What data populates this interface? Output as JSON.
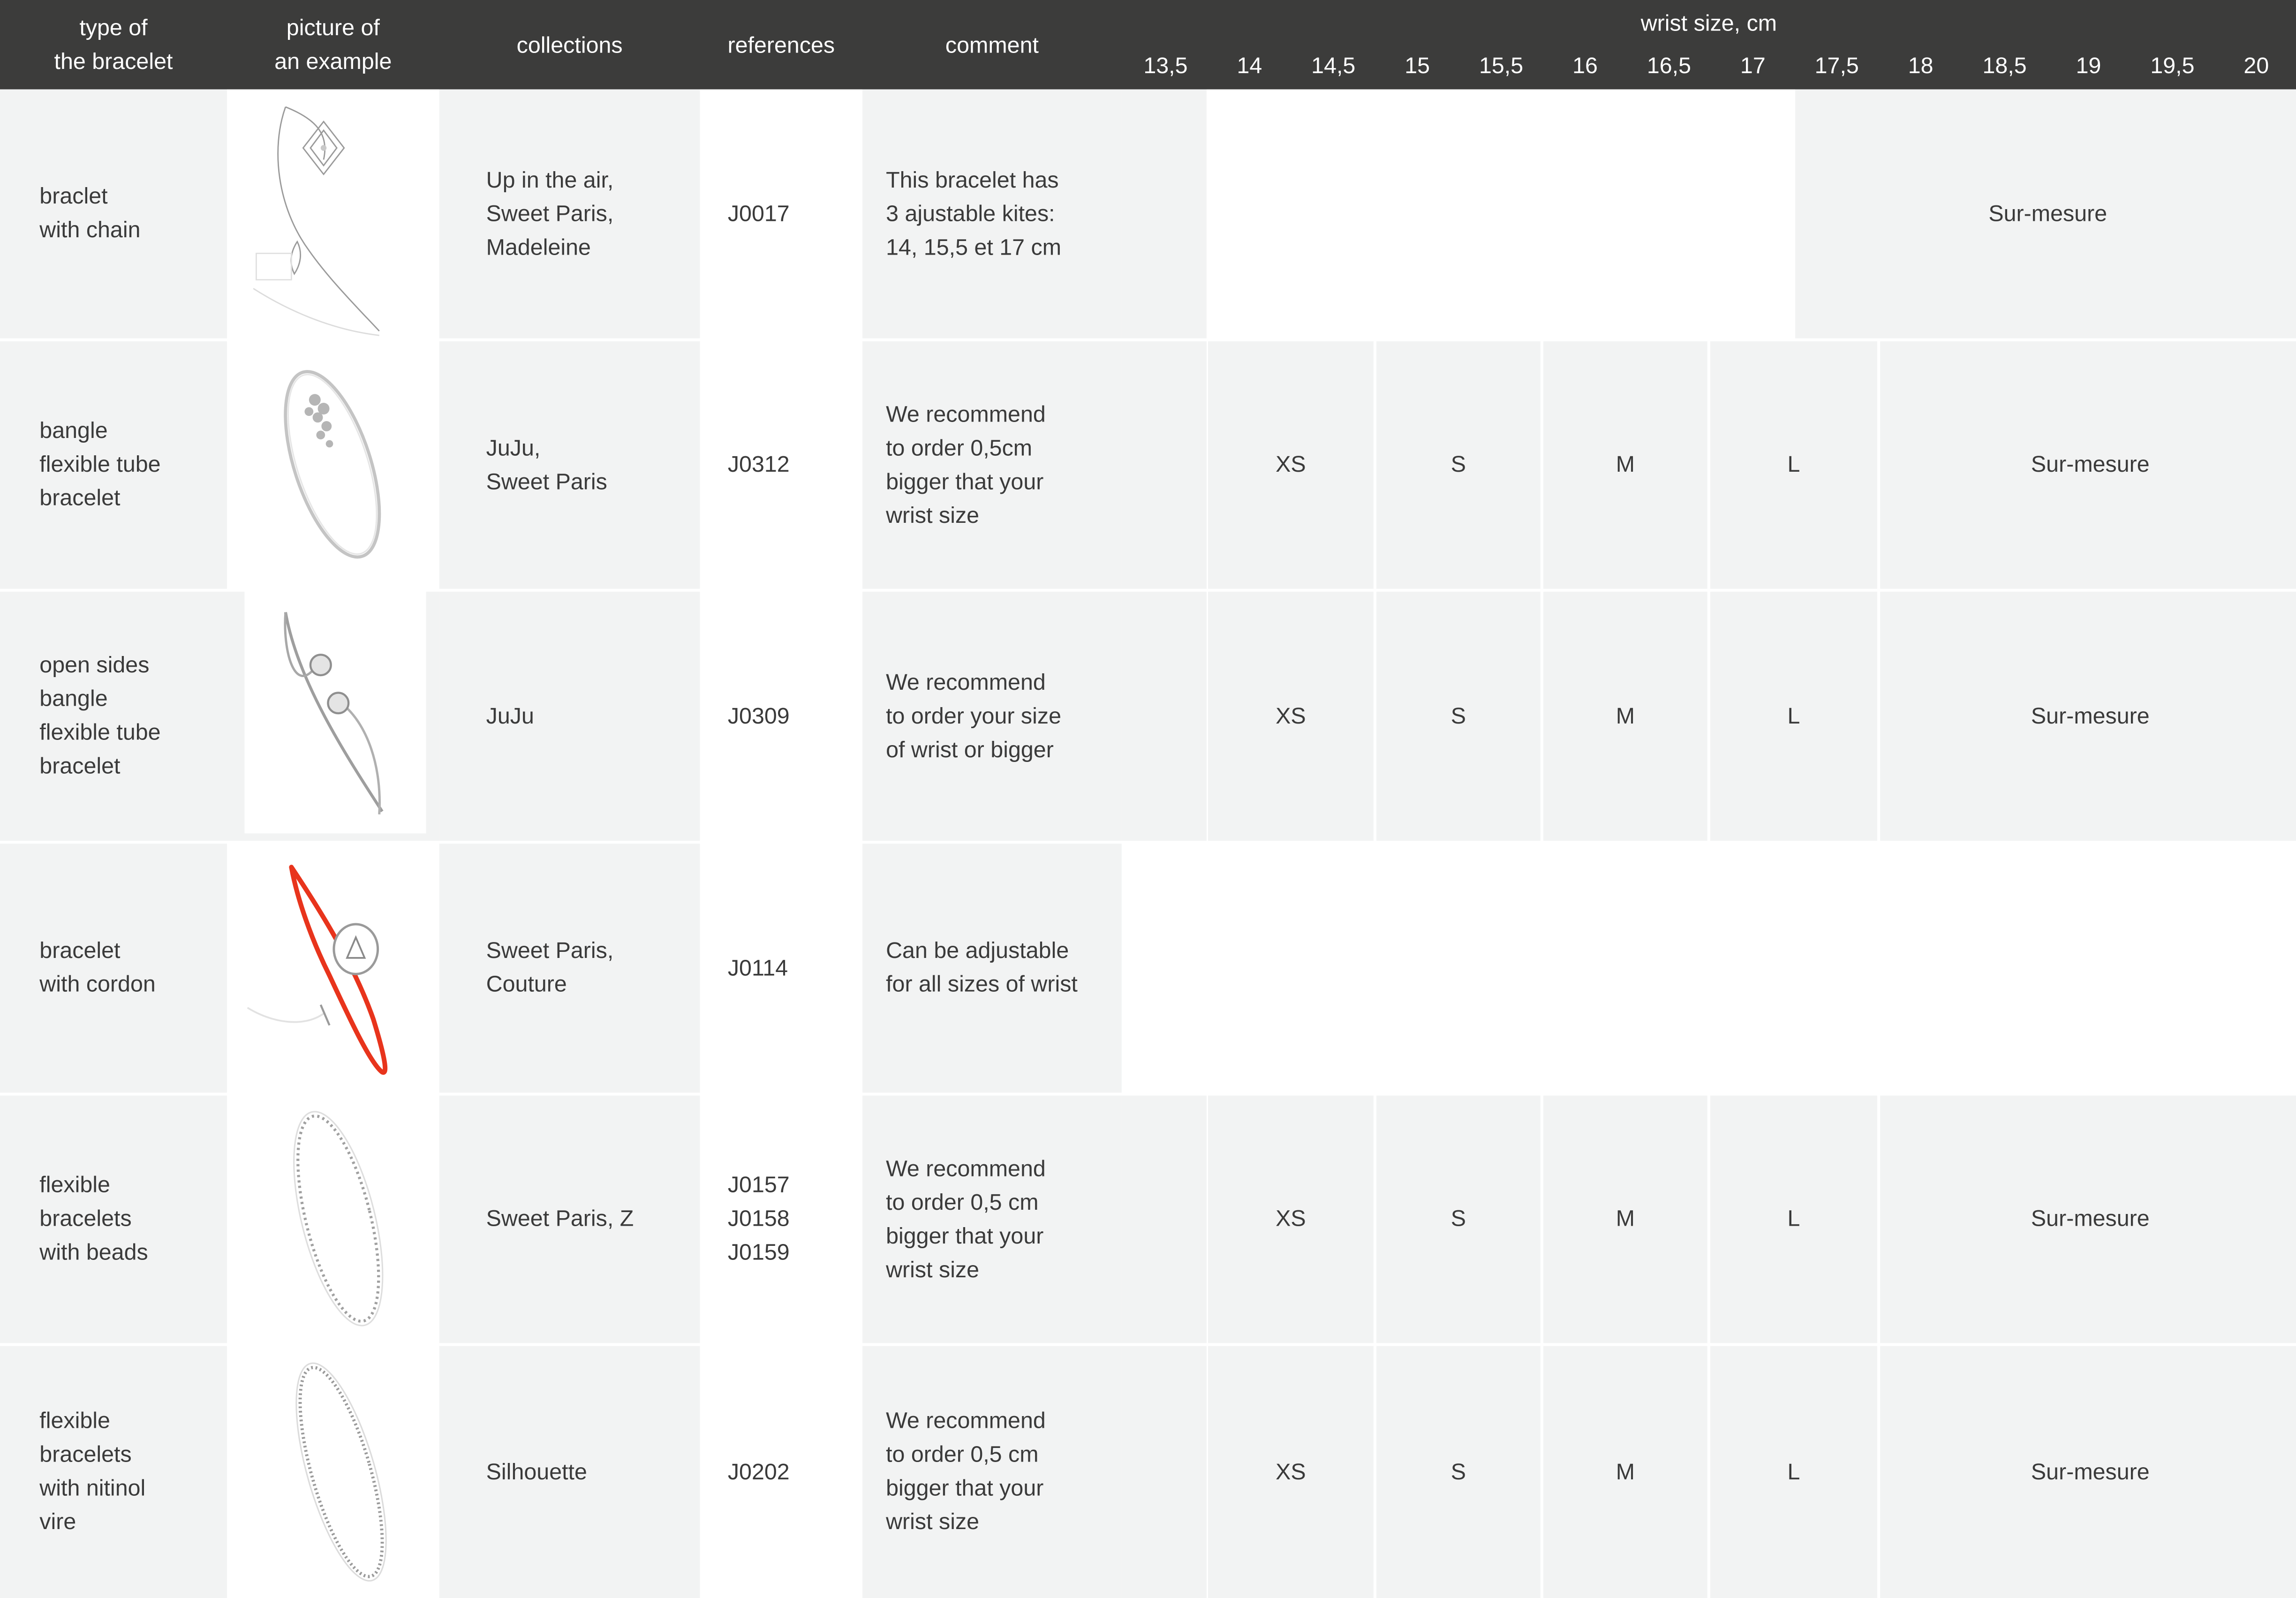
{
  "header": {
    "type": "type of\nthe bracelet",
    "picture": "picture of\nan example",
    "collections": "collections",
    "references": "references",
    "comment": "comment",
    "wrist": "wrist size, cm",
    "sizes": [
      "13,5",
      "14",
      "14,5",
      "15",
      "15,5",
      "16",
      "16,5",
      "17",
      "17,5",
      "18",
      "18,5",
      "19",
      "19,5",
      "20"
    ]
  },
  "rows": [
    {
      "type": "braclet\nwith chain",
      "picture_icon": "chain-bracelet-with-diamond-kite-icon",
      "collections": "Up in the air,\nSweet Paris,\nMadeleine",
      "references": "J0017",
      "comment": "This bracelet has\n3 ajustable kites:\n14, 15,5 et 17 cm",
      "surmesure": "Sur-mesure"
    },
    {
      "type": "bangle\nflexible tube\nbracelet",
      "picture_icon": "bangle-with-diamond-cluster-icon",
      "collections": "JuJu,\nSweet Paris",
      "references": "J0312",
      "comment": "We recommend\nto order 0,5cm\nbigger that your\nwrist size",
      "sizes": [
        "XS",
        "S",
        "M",
        "L"
      ],
      "surmesure": "Sur-mesure"
    },
    {
      "type": "open sides\nbangle\nflexible tube\nbracelet",
      "picture_icon": "open-bangle-with-two-stones-icon",
      "collections": "JuJu",
      "references": "J0309",
      "comment": "We recommend\nto order your size\nof wrist or bigger",
      "sizes": [
        "XS",
        "S",
        "M",
        "L"
      ],
      "surmesure": "Sur-mesure"
    },
    {
      "type": "bracelet\nwith cordon",
      "picture_icon": "red-cord-bracelet-icon",
      "collections": "Sweet Paris,\nCouture",
      "references": "J0114",
      "comment": "Can be adjustable\nfor all sizes of wrist"
    },
    {
      "type": "flexible\nbracelets\nwith beads",
      "picture_icon": "beaded-bangle-icon",
      "collections": "Sweet Paris, Z",
      "references": "J0157\nJ0158\nJ0159",
      "comment": "We recommend\nto order 0,5 cm\nbigger that your\nwrist size",
      "sizes": [
        "XS",
        "S",
        "M",
        "L"
      ],
      "surmesure": "Sur-mesure"
    },
    {
      "type": "flexible\nbracelets\nwith nitinol\nvire",
      "picture_icon": "nitinol-bangle-icon",
      "collections": "Silhouette",
      "references": "J0202",
      "comment": "We recommend\nto order 0,5 cm\nbigger that your\nwrist size",
      "sizes": [
        "XS",
        "S",
        "M",
        "L"
      ],
      "surmesure": "Sur-mesure"
    }
  ],
  "colors": {
    "header_bg": "#3c3c3b",
    "cell_bg": "#f2f3f3",
    "cord_red": "#e8341c"
  }
}
